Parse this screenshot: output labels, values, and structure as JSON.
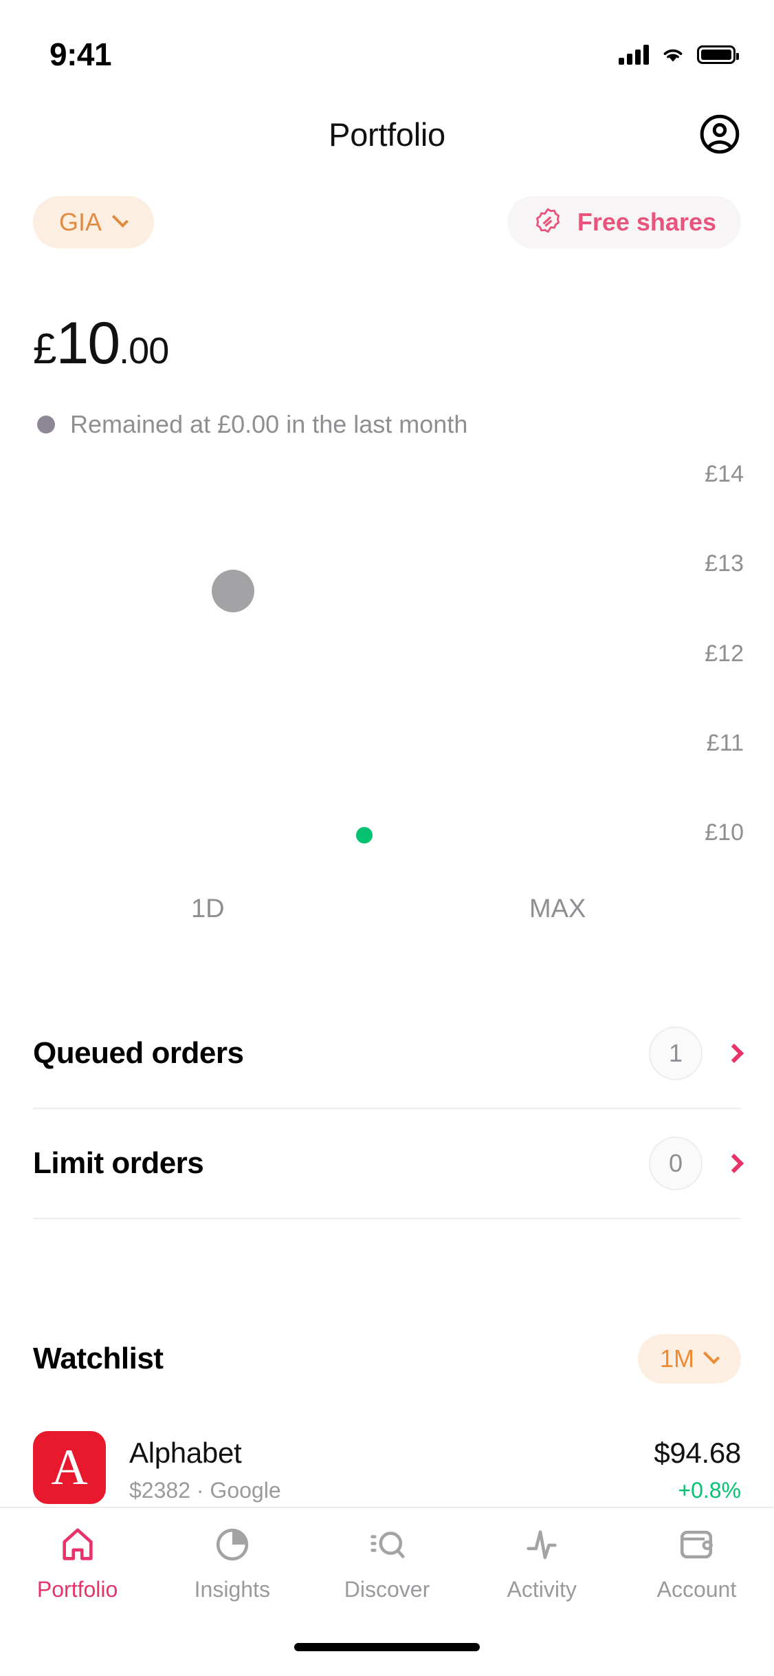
{
  "status_bar": {
    "time": "9:41",
    "cellular_icon": "cellular-bars-icon",
    "wifi_icon": "wifi-icon",
    "battery_icon": "battery-full-icon"
  },
  "header": {
    "title": "Portfolio",
    "account_icon": "account-circle-icon"
  },
  "chips": {
    "account_type": "GIA",
    "account_type_chevron": "chevron-down-icon",
    "free_shares_label": "Free shares",
    "free_shares_icon": "ticket-badge-icon"
  },
  "balance": {
    "currency": "£",
    "integer": "10",
    "decimal": ".00",
    "change_text": "Remained at £0.00 in the last month",
    "change_dot_color": "#8E8796"
  },
  "chart_data": {
    "type": "scatter",
    "title": "",
    "xlabel": "",
    "ylabel": "",
    "y_ticks": [
      "£14",
      "£13",
      "£12",
      "£11",
      "£10"
    ],
    "ylim": [
      10,
      14
    ],
    "x_ticks": [
      "1D",
      "MAX"
    ],
    "grid": false,
    "legend": false,
    "series": [
      {
        "name": "selected-point",
        "color": "#A3A3A5",
        "points": [
          {
            "x": "1D",
            "y": 12.9,
            "marker": "large-circle"
          }
        ]
      },
      {
        "name": "current-value",
        "color": "#05C270",
        "points": [
          {
            "x": "MAX",
            "y": 10.0,
            "marker": "small-circle"
          }
        ]
      }
    ]
  },
  "orders": [
    {
      "title": "Queued orders",
      "count": "1",
      "chevron": "chevron-right-icon"
    },
    {
      "title": "Limit orders",
      "count": "0",
      "chevron": "chevron-right-icon"
    }
  ],
  "watchlist": {
    "title": "Watchlist",
    "range": "1M",
    "range_chevron": "chevron-down-icon",
    "items": [
      {
        "logo_letter": "A",
        "logo_color": "#E8192C",
        "name": "Alphabet",
        "subtitle": "$2382 · Google",
        "price": "$94.68",
        "change": "+0.8%"
      }
    ]
  },
  "tab_bar": {
    "items": [
      {
        "label": "Portfolio",
        "icon": "home-icon",
        "active": true
      },
      {
        "label": "Insights",
        "icon": "pie-chart-icon",
        "active": false
      },
      {
        "label": "Discover",
        "icon": "search-list-icon",
        "active": false
      },
      {
        "label": "Activity",
        "icon": "pulse-icon",
        "active": false
      },
      {
        "label": "Account",
        "icon": "wallet-icon",
        "active": false
      }
    ]
  },
  "colors": {
    "accent_pink": "#E8326A",
    "accent_orange": "#EE8B35",
    "positive_green": "#05C270",
    "muted_gray": "#8E8E93"
  }
}
